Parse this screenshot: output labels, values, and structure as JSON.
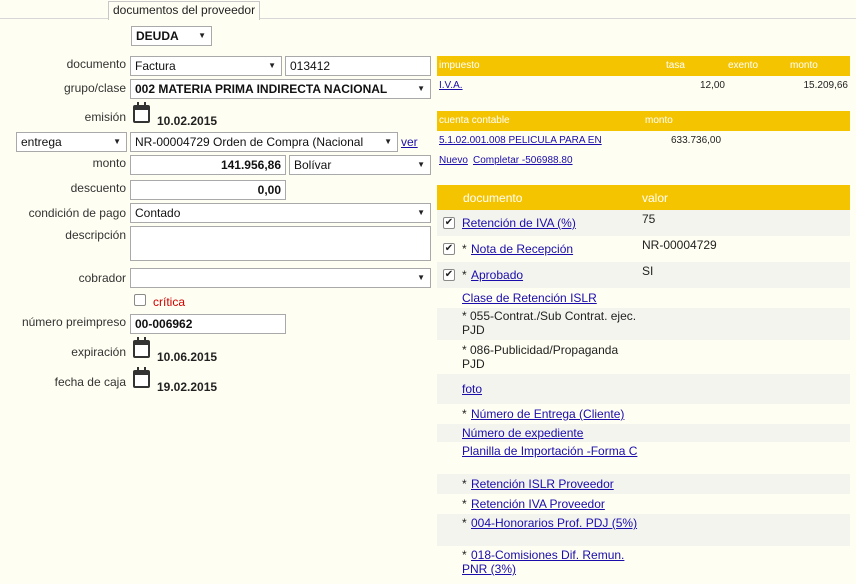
{
  "tab": {
    "label": "documentos del proveedor"
  },
  "form": {
    "tipo": "DEUDA",
    "documento_label": "documento",
    "documento_tipo": "Factura",
    "documento_numero": "013412",
    "grupo_label": "grupo/clase",
    "grupo_value": "002 MATERIA PRIMA INDIRECTA NACIONAL",
    "emision_label": "emisión",
    "emision_date": "10.02.2015",
    "entrega_select": "entrega",
    "entrega_value": "NR-00004729 Orden de Compra (Nacional",
    "ver_link": "ver",
    "monto_label": "monto",
    "monto_value": "141.956,86",
    "moneda": "Bolívar",
    "descuento_label": "descuento",
    "descuento_value": "0,00",
    "condicion_label": "condición de pago",
    "condicion_value": "Contado",
    "descripcion_label": "descripción",
    "descripcion_value": "",
    "cobrador_label": "cobrador",
    "cobrador_value": "",
    "critica_label": "crítica",
    "preimpreso_label": "número preimpreso",
    "preimpreso_value": "00-006962",
    "expiracion_label": "expiración",
    "expiracion_date": "10.06.2015",
    "caja_label": "fecha de caja",
    "caja_date": "19.02.2015"
  },
  "impuestos": {
    "headers": [
      "impuesto",
      "tasa",
      "exento",
      "monto"
    ],
    "row": {
      "impuesto": "I.V.A.",
      "tasa": "12,00",
      "exento": "",
      "monto": "15.209,66"
    }
  },
  "cuentas": {
    "headers": [
      "cuenta contable",
      "monto"
    ],
    "row": {
      "cuenta": "5.1.02.001.008 PELICULA PARA EN",
      "monto": "633.736,00"
    },
    "nuevo": "Nuevo",
    "completar": "Completar -506988.80"
  },
  "documentos": {
    "headers": [
      "documento",
      "valor"
    ],
    "checked_rows": [
      {
        "prefix": "",
        "label": "Retención de IVA (%)",
        "value": "75"
      },
      {
        "prefix": "* ",
        "label": "Nota de Recepción",
        "value": "NR-00004729"
      },
      {
        "prefix": "* ",
        "label": "Aprobado",
        "value": "SI"
      }
    ],
    "clase_isl": "Clase de Retención ISLR",
    "isl_055": "* 055-Contrat./Sub Contrat. ejec. PJD",
    "isl_086": "* 086-Publicidad/Propaganda PJD",
    "foto": "foto",
    "entrega_cliente": "Número de Entrega (Cliente)",
    "expediente": "Número de expediente",
    "planilla": "Planilla de Importación -Forma C",
    "ret_islr_prov": "Retención ISLR Proveedor",
    "ret_iva_prov": "Retención IVA Proveedor",
    "honorarios": "004-Honorarios Prof. PDJ (5%)",
    "comisiones": "018-Comisiones Dif. Remun. PNR (3%)",
    "star": "* "
  }
}
